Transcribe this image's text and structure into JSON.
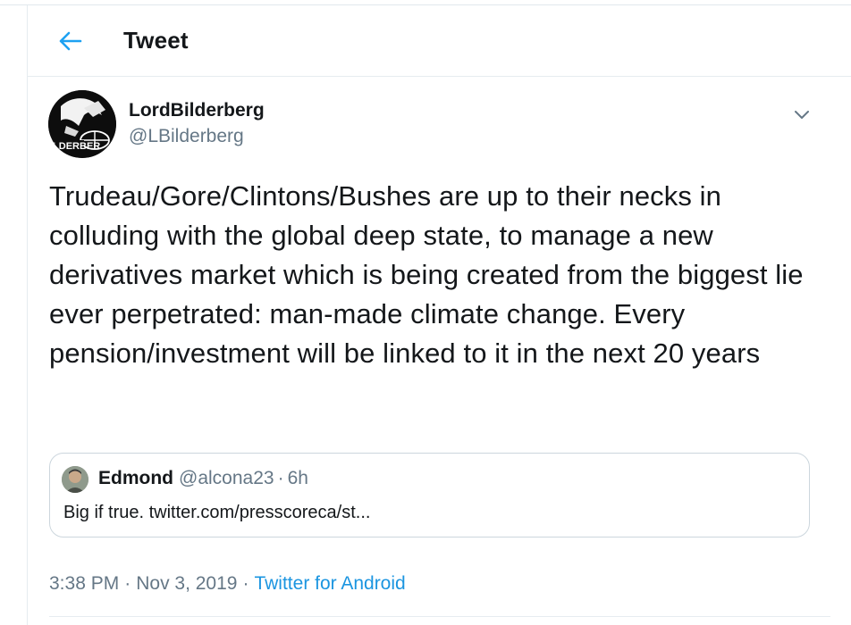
{
  "header": {
    "title": "Tweet",
    "back_icon": "arrow-left-icon",
    "accent_color": "#1da1f2"
  },
  "tweet": {
    "avatar_text": "ILDERBER",
    "display_name": "LordBilderberg",
    "handle": "@LBilderberg",
    "menu_icon": "chevron-down-icon",
    "text": "Trudeau/Gore/Clintons/Bushes are up to their necks in colluding with the global deep state, to manage a new derivatives market which is being created from the biggest lie ever perpetrated: man-made climate change. Every pension/investment will be linked to it in the next 20 years",
    "quoted": {
      "display_name": "Edmond",
      "handle": "@alcona23",
      "separator": "·",
      "time": "6h",
      "text": "Big if true. twitter.com/presscoreca/st..."
    },
    "meta": {
      "time": "3:38 PM",
      "separator": "·",
      "date": "Nov 3, 2019",
      "source": "Twitter for Android"
    }
  }
}
